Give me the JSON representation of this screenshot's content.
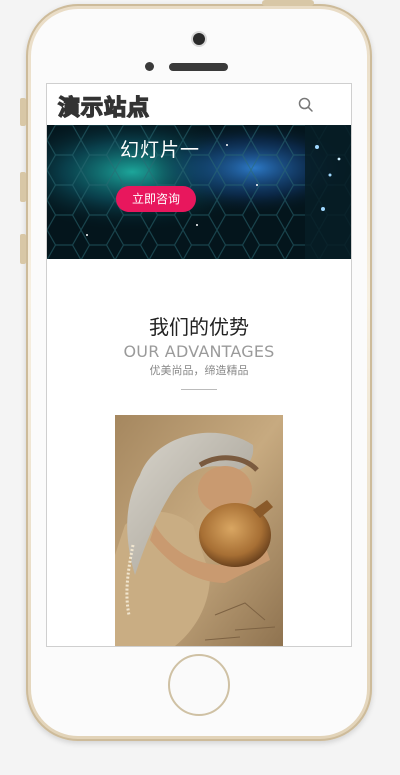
{
  "header": {
    "logo_text": "演示站点",
    "search_icon": "search-icon"
  },
  "banner": {
    "title": "幻灯片一",
    "button_label": "立即咨询",
    "button_color": "#e8175d"
  },
  "advantages": {
    "title": "我们的优势",
    "subtitle": "OUR ADVANTAGES",
    "description": "优美尚品，缔造精品"
  },
  "photo": {
    "subject": "woman-with-clay-jar-photo"
  }
}
